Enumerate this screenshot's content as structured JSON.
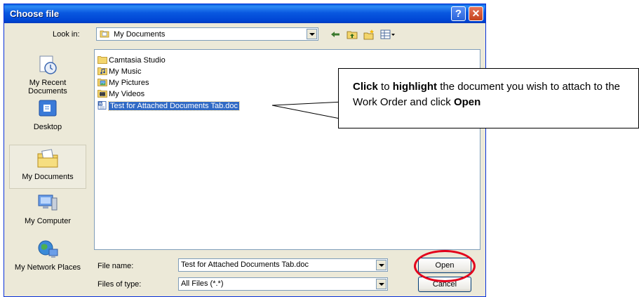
{
  "dialog": {
    "title": "Choose file",
    "help_glyph": "?",
    "close_glyph": "✕"
  },
  "lookin": {
    "label": "Look in:",
    "value": "My Documents"
  },
  "toolbar": {
    "icons": [
      "back-arrow-icon",
      "up-folder-icon",
      "new-folder-icon",
      "views-menu-icon"
    ]
  },
  "places": [
    {
      "label": "My Recent Documents",
      "icon": "recent-documents-icon"
    },
    {
      "label": "Desktop",
      "icon": "desktop-icon"
    },
    {
      "label": "My Documents",
      "icon": "my-documents-icon",
      "selected": true
    },
    {
      "label": "My Computer",
      "icon": "my-computer-icon"
    },
    {
      "label": "My Network Places",
      "icon": "network-places-icon"
    }
  ],
  "files": [
    {
      "name": "Camtasia Studio",
      "icon": "folder-icon"
    },
    {
      "name": "My Music",
      "icon": "music-folder-icon"
    },
    {
      "name": "My Pictures",
      "icon": "pictures-folder-icon"
    },
    {
      "name": "My Videos",
      "icon": "videos-folder-icon"
    },
    {
      "name": "Test for Attached Documents Tab.doc",
      "icon": "word-doc-icon",
      "selected": true
    }
  ],
  "filename": {
    "label": "File name:",
    "value": "Test for Attached Documents Tab.doc"
  },
  "filetype": {
    "label": "Files of type:",
    "value": "All Files (*.*)"
  },
  "buttons": {
    "open": "Open",
    "cancel": "Cancel"
  },
  "callout": {
    "part1": "Click",
    "part2": " to ",
    "part3": "highlight",
    "part4": " the document you wish to attach to the Work Order and click ",
    "part5": "Open"
  },
  "colors": {
    "title_bar": "#0058e6",
    "selection": "#316ac5",
    "highlight_oval": "#e3001b"
  }
}
